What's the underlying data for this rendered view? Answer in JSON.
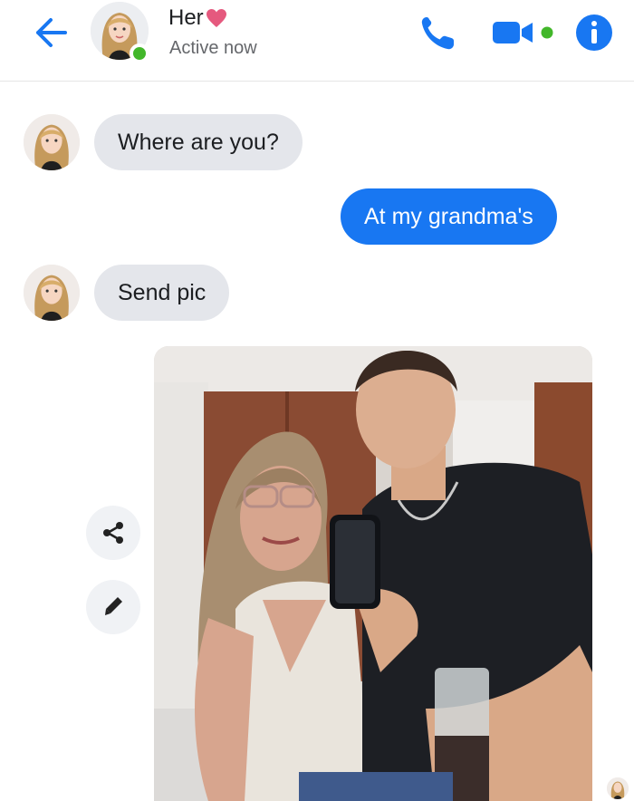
{
  "header": {
    "contact_name": "Her",
    "status": "Active now",
    "accent_color": "#1877f2",
    "presence_color": "#42b72a",
    "icons": [
      "back-arrow-icon",
      "heart-icon",
      "phone-icon",
      "video-camera-icon",
      "info-icon"
    ]
  },
  "messages": [
    {
      "direction": "incoming",
      "text": "Where are you?"
    },
    {
      "direction": "outgoing",
      "text": "At my grandma's"
    },
    {
      "direction": "incoming",
      "text": "Send pic"
    },
    {
      "direction": "outgoing",
      "type": "photo"
    }
  ],
  "colors": {
    "incoming_bubble": "#e4e6eb",
    "outgoing_bubble": "#1877f2"
  },
  "photo_actions": [
    "share-icon",
    "edit-pencil-icon"
  ]
}
